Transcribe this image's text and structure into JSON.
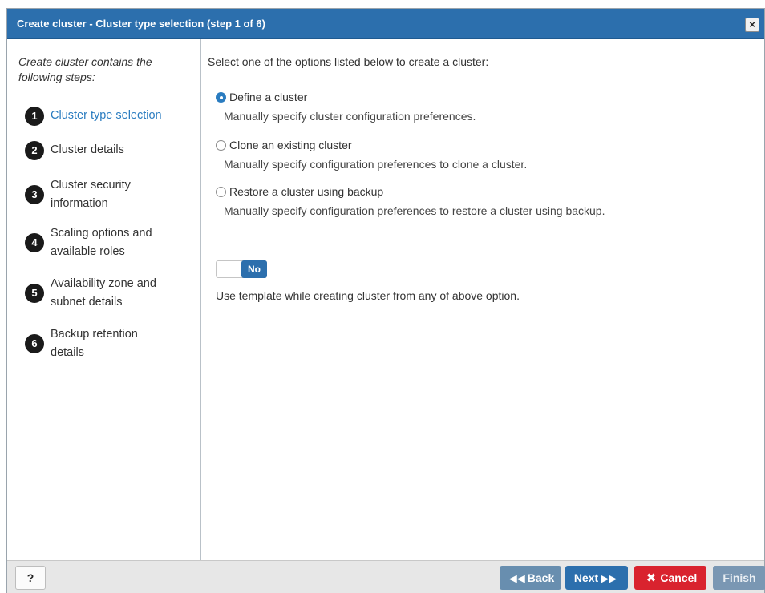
{
  "dialog": {
    "title": "Create cluster - Cluster type selection (step 1 of 6)",
    "close_icon": "×"
  },
  "sidebar": {
    "intro": "Create cluster contains the following steps:",
    "steps": [
      {
        "number": "1",
        "label": "Cluster type selection",
        "active": true
      },
      {
        "number": "2",
        "label": "Cluster details"
      },
      {
        "number": "3",
        "label": "Cluster security information"
      },
      {
        "number": "4",
        "label": "Scaling options and available roles"
      },
      {
        "number": "5",
        "label": "Availability zone and subnet details"
      },
      {
        "number": "6",
        "label": "Backup retention details"
      }
    ]
  },
  "main": {
    "intro": "Select one of the options listed below to create a cluster:",
    "options": [
      {
        "label": "Define a cluster",
        "description": "Manually specify cluster configuration preferences.",
        "selected": true
      },
      {
        "label": "Clone an existing cluster",
        "description": "Manually specify configuration preferences to clone a cluster."
      },
      {
        "label": "Restore a cluster using backup",
        "description": "Manually specify configuration preferences to restore a cluster using backup."
      }
    ],
    "template_toggle": {
      "value": "No",
      "description": "Use template while creating cluster from any of above option."
    }
  },
  "footer": {
    "help": "?",
    "back": "Back",
    "next": "Next",
    "cancel": "Cancel",
    "finish": "Finish",
    "back_icon": "◀◀",
    "next_icon": "▶▶",
    "cancel_icon": "✖"
  },
  "colors": {
    "titlebar": "#2c6fad",
    "active_step": "#2a7cc0",
    "cancel": "#d9232e",
    "next": "#2c6fad"
  }
}
